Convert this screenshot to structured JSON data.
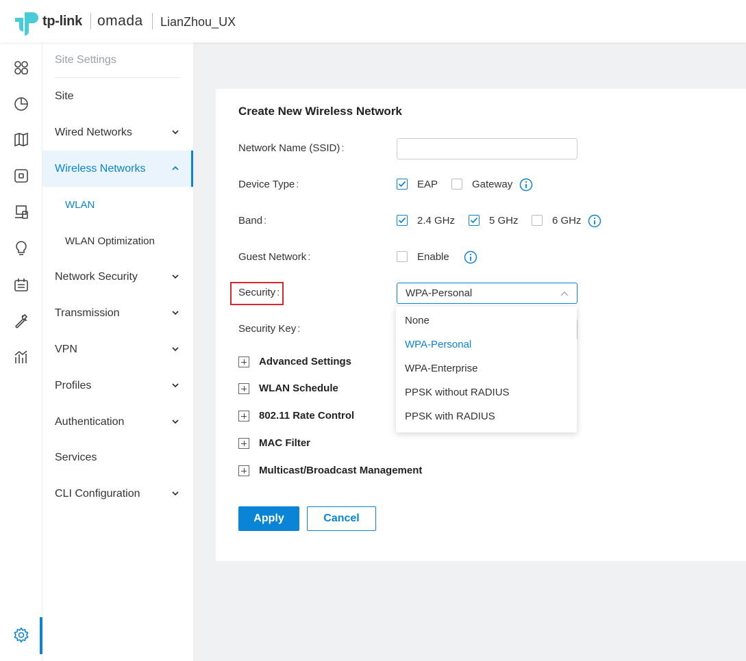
{
  "header": {
    "brand": "tp-link",
    "product": "omada",
    "site_name": "LianZhou_UX"
  },
  "rail": {
    "icons": [
      "dashboard-icon",
      "statistics-icon",
      "map-icon",
      "devices-icon",
      "clients-icon",
      "insights-icon",
      "logs-icon",
      "tools-icon",
      "reports-icon",
      "settings-icon"
    ]
  },
  "subnav": {
    "title": "Site Settings",
    "items": [
      {
        "label": "Site"
      },
      {
        "label": "Wired Networks"
      },
      {
        "label": "Wireless Networks"
      },
      {
        "label": "WLAN"
      },
      {
        "label": "WLAN Optimization"
      },
      {
        "label": "Network Security"
      },
      {
        "label": "Transmission"
      },
      {
        "label": "VPN"
      },
      {
        "label": "Profiles"
      },
      {
        "label": "Authentication"
      },
      {
        "label": "Services"
      },
      {
        "label": "CLI Configuration"
      }
    ]
  },
  "form": {
    "title": "Create New Wireless Network",
    "ssid_label": "Network Name (SSID)",
    "ssid_value": "",
    "device_type_label": "Device Type",
    "device_type": {
      "eap": "EAP",
      "eap_checked": true,
      "gateway": "Gateway",
      "gateway_checked": false
    },
    "band_label": "Band",
    "band": {
      "b24": "2.4 GHz",
      "b24_checked": true,
      "b5": "5 GHz",
      "b5_checked": true,
      "b6": "6 GHz",
      "b6_checked": false
    },
    "guest_label": "Guest Network",
    "guest": {
      "enable": "Enable",
      "enable_checked": false
    },
    "security_label": "Security",
    "security_value": "WPA-Personal",
    "security_key_label": "Security Key",
    "colon": ":",
    "sections": [
      "Advanced Settings",
      "WLAN Schedule",
      "802.11 Rate Control",
      "MAC Filter",
      "Multicast/Broadcast Management"
    ],
    "apply": "Apply",
    "cancel": "Cancel"
  },
  "dropdown": {
    "options": [
      "None",
      "WPA-Personal",
      "WPA-Enterprise",
      "PPSK without RADIUS",
      "PPSK with RADIUS"
    ],
    "selected": "WPA-Personal"
  },
  "colors": {
    "accent": "#0a84d6",
    "highlight": "#d9262c"
  }
}
